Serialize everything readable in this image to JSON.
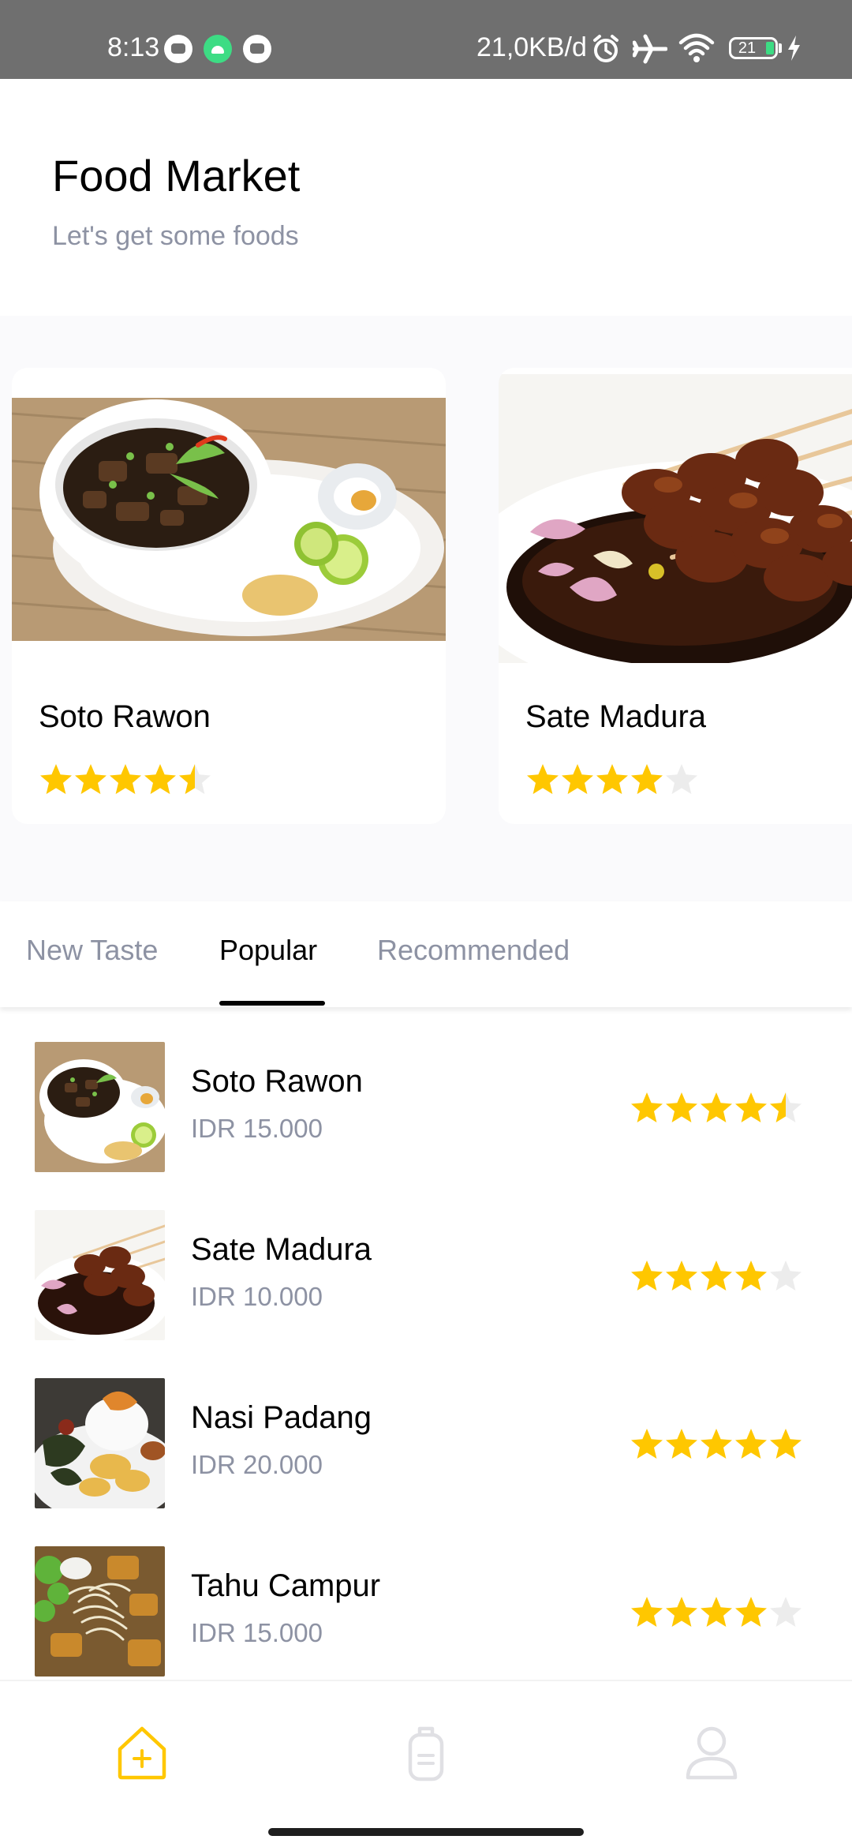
{
  "status_bar": {
    "time": "8:13",
    "network_speed": "21,0KB/d",
    "battery_level": "21",
    "icons": [
      "app-notification-icon",
      "android-icon",
      "app-notification-icon",
      "alarm-icon",
      "airplane-mode-icon",
      "wifi-icon",
      "battery-icon",
      "charging-icon"
    ]
  },
  "header": {
    "title": "Food Market",
    "subtitle": "Let's get some foods"
  },
  "featured": [
    {
      "name": "Soto Rawon",
      "rating": 4.5,
      "image": "soto-rawon-photo"
    },
    {
      "name": "Sate Madura",
      "rating": 4,
      "image": "sate-madura-photo"
    }
  ],
  "tabs": [
    {
      "label": "New Taste",
      "active": false
    },
    {
      "label": "Popular",
      "active": true
    },
    {
      "label": "Recommended",
      "active": false
    }
  ],
  "foods": [
    {
      "name": "Soto Rawon",
      "price": "IDR 15.000",
      "rating": 4.5,
      "image": "soto-rawon-photo"
    },
    {
      "name": "Sate Madura",
      "price": "IDR 10.000",
      "rating": 4,
      "image": "sate-madura-photo"
    },
    {
      "name": "Nasi Padang",
      "price": "IDR 20.000",
      "rating": 5,
      "image": "nasi-padang-photo"
    },
    {
      "name": "Tahu Campur",
      "price": "IDR 15.000",
      "rating": 4,
      "image": "tahu-campur-photo"
    }
  ],
  "bottom_nav": [
    {
      "icon": "home-icon",
      "active": true
    },
    {
      "icon": "orders-icon",
      "active": false
    },
    {
      "icon": "profile-icon",
      "active": false
    }
  ],
  "colors": {
    "star": "#ffc700",
    "star_empty": "#ececec",
    "accent": "#ffc700",
    "text_primary": "#020202",
    "text_secondary": "#8d92a3",
    "status_bar": "#6f6f6f"
  }
}
